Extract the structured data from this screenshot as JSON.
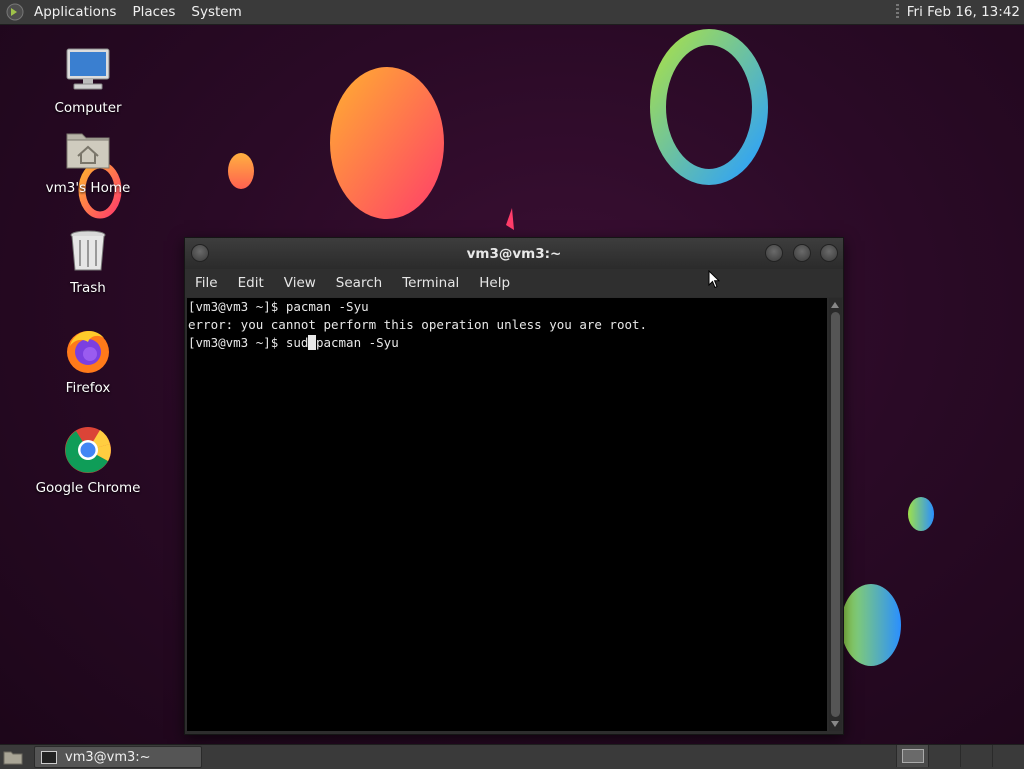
{
  "top_panel": {
    "menus": [
      "Applications",
      "Places",
      "System"
    ],
    "clock": "Fri Feb 16, 13:42"
  },
  "desktop": {
    "icons": [
      {
        "label": "Computer",
        "icon": "computer-icon"
      },
      {
        "label": "vm3's Home",
        "icon": "home-folder-icon"
      },
      {
        "label": "Trash",
        "icon": "trash-icon"
      },
      {
        "label": "Firefox",
        "icon": "firefox-icon"
      },
      {
        "label": "Google Chrome",
        "icon": "chrome-icon"
      }
    ]
  },
  "terminal": {
    "title": "vm3@vm3:~",
    "menu": [
      "File",
      "Edit",
      "View",
      "Search",
      "Terminal",
      "Help"
    ],
    "lines": [
      "[vm3@vm3 ~]$ pacman -Syu",
      "error: you cannot perform this operation unless you are root."
    ],
    "current_prompt": "[vm3@vm3 ~]$ ",
    "input_before_cursor": "sud",
    "input_after_cursor": "pacman -Syu"
  },
  "bottom_panel": {
    "task_label": "vm3@vm3:~"
  },
  "colors": {
    "desktop_bg": "#2a0a26",
    "panel_bg": "#3a3a3a",
    "terminal_bg": "#000000"
  }
}
